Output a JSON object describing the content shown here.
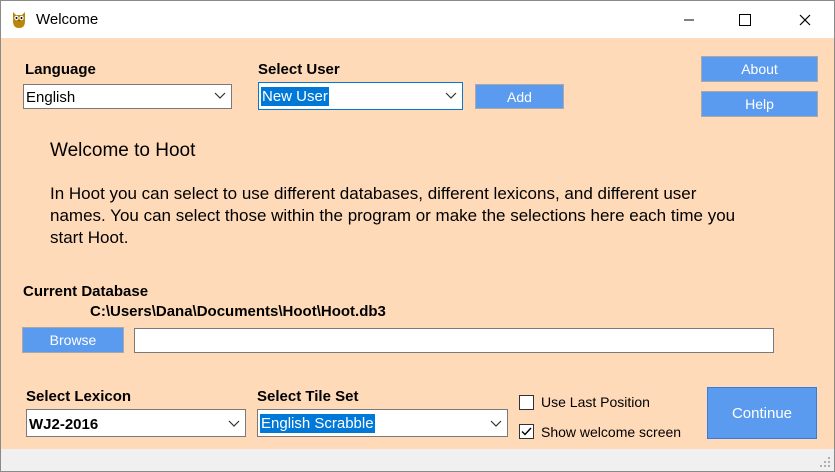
{
  "window": {
    "title": "Welcome",
    "title_icon": "owl-icon"
  },
  "language": {
    "label": "Language",
    "selected": "English"
  },
  "user": {
    "label": "Select User",
    "selected": "New User",
    "add_label": "Add"
  },
  "about_label": "About",
  "help_label": "Help",
  "welcome": {
    "heading": "Welcome to Hoot",
    "line1": "In Hoot you can select to use different databases, different lexicons, and different user",
    "line2": "names. You can select those within the program or make the selections here each time you",
    "line3": "start Hoot."
  },
  "database": {
    "label": "Current Database",
    "path": "C:\\Users\\Dana\\Documents\\Hoot\\Hoot.db3",
    "browse_label": "Browse",
    "input_value": ""
  },
  "lexicon": {
    "label": "Select Lexicon",
    "selected": "WJ2-2016"
  },
  "tileset": {
    "label": "Select Tile Set",
    "selected": "English Scrabble"
  },
  "options": {
    "use_last_position": {
      "label": "Use Last Position",
      "checked": false
    },
    "show_welcome": {
      "label": "Show welcome screen",
      "checked": true
    }
  },
  "continue_label": "Continue",
  "colors": {
    "background": "#ffdab9",
    "button": "#5b9bef",
    "highlight": "#0078d7"
  }
}
